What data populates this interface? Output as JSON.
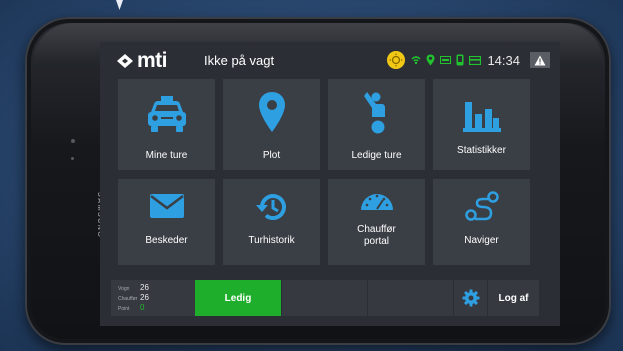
{
  "header": {
    "logo_text": "mti",
    "shift_status": "Ikke på vagt",
    "clock": "14:34"
  },
  "device": {
    "brand": "SAMSUNG"
  },
  "tiles": [
    {
      "label": "Mine ture",
      "icon": "taxi-icon"
    },
    {
      "label": "Plot",
      "icon": "map-pin-icon"
    },
    {
      "label": "Ledige ture",
      "icon": "hailing-person-icon"
    },
    {
      "label": "Statistikker",
      "icon": "bar-chart-icon"
    },
    {
      "label": "Beskeder",
      "icon": "envelope-icon"
    },
    {
      "label": "Turhistorik",
      "icon": "history-icon"
    },
    {
      "label": "Chauffør\nportal",
      "icon": "speedometer-icon"
    },
    {
      "label": "Naviger",
      "icon": "route-icon"
    }
  ],
  "bottom_bar": {
    "counts": [
      {
        "label": "Vogn",
        "value": "26"
      },
      {
        "label": "Chauffør",
        "value": "26"
      },
      {
        "label": "Point",
        "value": "0"
      }
    ],
    "ledig_label": "Ledig",
    "logout_label": "Log af"
  },
  "colors": {
    "accent_blue": "#2e9fe0",
    "status_green": "#1fad2c",
    "sun_yellow": "#f2c816",
    "tile_bg": "#3a3e45",
    "screen_bg": "#2b2f35"
  }
}
